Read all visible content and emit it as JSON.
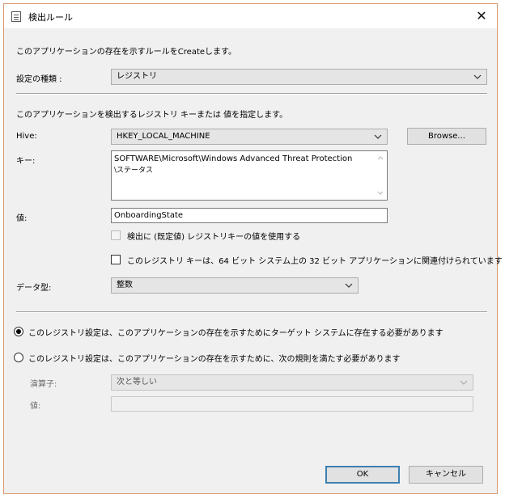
{
  "window": {
    "title": "検出ルール",
    "close_glyph": "✕"
  },
  "intro_text": "このアプリケーションの存在を示すルールをCreateします。",
  "rule_type": {
    "label": "設定の種類 :",
    "value": "レジストリ"
  },
  "section_text": "このアプリケーションを検出するレジストリ キーまたは 値を指定します。",
  "hive": {
    "label": "Hive:",
    "value": "HKEY_LOCAL_MACHINE",
    "browse_label": "Browse..."
  },
  "key": {
    "label": "キー:",
    "line1": "SOFTWARE\\Microsoft\\Windows Advanced Threat Protection",
    "line2": "\\ステータス"
  },
  "value": {
    "label": "値:",
    "value": "OnboardingState"
  },
  "use_default_checkbox": {
    "label": "検出に (既定値) レジストリキーの値を使用する",
    "checked": false
  },
  "wow64_checkbox": {
    "label": "このレジストリ キーは、64 ビット システム上の 32 ビット アプリケーションに関連付けられています",
    "checked": false
  },
  "data_type": {
    "label": "データ型:",
    "value": "整数"
  },
  "radio_exist": {
    "label": "このレジストリ設定は、このアプリケーションの存在を示すためにターゲット システムに存在する必要があります",
    "selected": true
  },
  "radio_rule": {
    "label": "このレジストリ設定は、このアプリケーションの存在を示すために、次の規則を満たす必要があります",
    "selected": false
  },
  "operator": {
    "label": "演算子:",
    "value": "次と等しい"
  },
  "rule_value": {
    "label": "値:",
    "value": ""
  },
  "buttons": {
    "ok": "OK",
    "cancel": "キャンセル"
  }
}
